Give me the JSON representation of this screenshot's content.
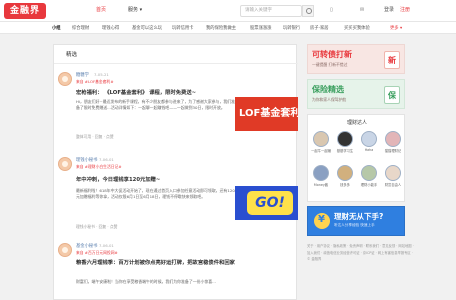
{
  "header": {
    "logo": "金融界",
    "nav": [
      "首页",
      "服务 ▾"
    ],
    "search_placeholder": "请输入关键字",
    "icons": [
      "mobile-icon",
      "mail-icon"
    ],
    "login": "登录",
    "register": "注册"
  },
  "categories": [
    "小组",
    "综合理财",
    "理钱心得",
    "基金可以这么玩",
    "玩转信用卡",
    "我的保险我做主",
    "股票涨涨涨",
    "玩转银行",
    "房子·家居",
    "买买买我体验",
    "更多 ▾"
  ],
  "main": {
    "title": "精选",
    "posts": [
      {
        "user": "糖糖学",
        "time": "7-05-21",
        "tag": "来自 #LOF基金套利#",
        "title": "宏枪福利： 《LOF基金套利》 课程，限时免费送~",
        "text": "Hi，朋友们好~最近发布的新手课程，有不少朋友都参与进来了，为了感谢大家参与，我们准备了限时免费赠送...活动详情如下：一起聊一起赚钱吧——一起做到30日，限时开放。",
        "meta": "整体可用 · 回复 · 点赞",
        "image_text": "LOF基金套利"
      },
      {
        "user": "理钱小秘书",
        "time": "7-06-01",
        "tag": "来自 #理财小白生活日记#",
        "title": "年中冲刺，今日理钱享120元加赠~",
        "text": "最新福利啦！618年中大促活动开始了，现在通过首页入口参加任意活动即可领取，还有120元加赠福利等你拿，活动仅限6月1日至6月18日，理钱不停歇快来领取吧。",
        "meta": "理钱小秘书 · 回复 · 点赞",
        "image_text": "GO!"
      },
      {
        "user": "基金小秘书",
        "time": "7-06-01",
        "tag": "来自 #百万日元网投网#",
        "title": "粮香六月理钱季：百万计划被你点亮好运打牌，把故宫稳债件和回家",
        "text": "财富们，端午安康啦！当你在享受粮香端午的时候，我们为你准备了一份小惊喜...",
        "meta": "",
        "image_text": ""
      }
    ]
  },
  "sidebar": {
    "ad1": {
      "title": "可转债打新",
      "subtitle": "一键提醒 打新不错过",
      "badge": "新"
    },
    "ad2": {
      "title": "保险精选",
      "subtitle": "为你和家人保驾护航",
      "badge": "保"
    },
    "experts": {
      "title": "理财达人",
      "names": [
        "一起牛一起赚",
        "基基学习生",
        "Haha",
        "猫猫理财记",
        "Money酱",
        "钱多多",
        "理财小能手",
        "财富自由人"
      ]
    },
    "promo": {
      "title": "理财无从下手?",
      "subtitle": "听达人分享经验 快速上手"
    },
    "footer": "关于 · 用户协议 · 隐私政策 · 免责声明 · 联系我们 · 意见反馈 · 网站地图 · 加入我们 · 增值电信业务经营许可证 · 京ICP证 · 网上有害信息举报专区 · © 金融界"
  },
  "colors": {
    "brand": "#e8383d",
    "link": "#5a7fae",
    "promo": "#2f7fe0",
    "green": "#3a9f5e"
  }
}
